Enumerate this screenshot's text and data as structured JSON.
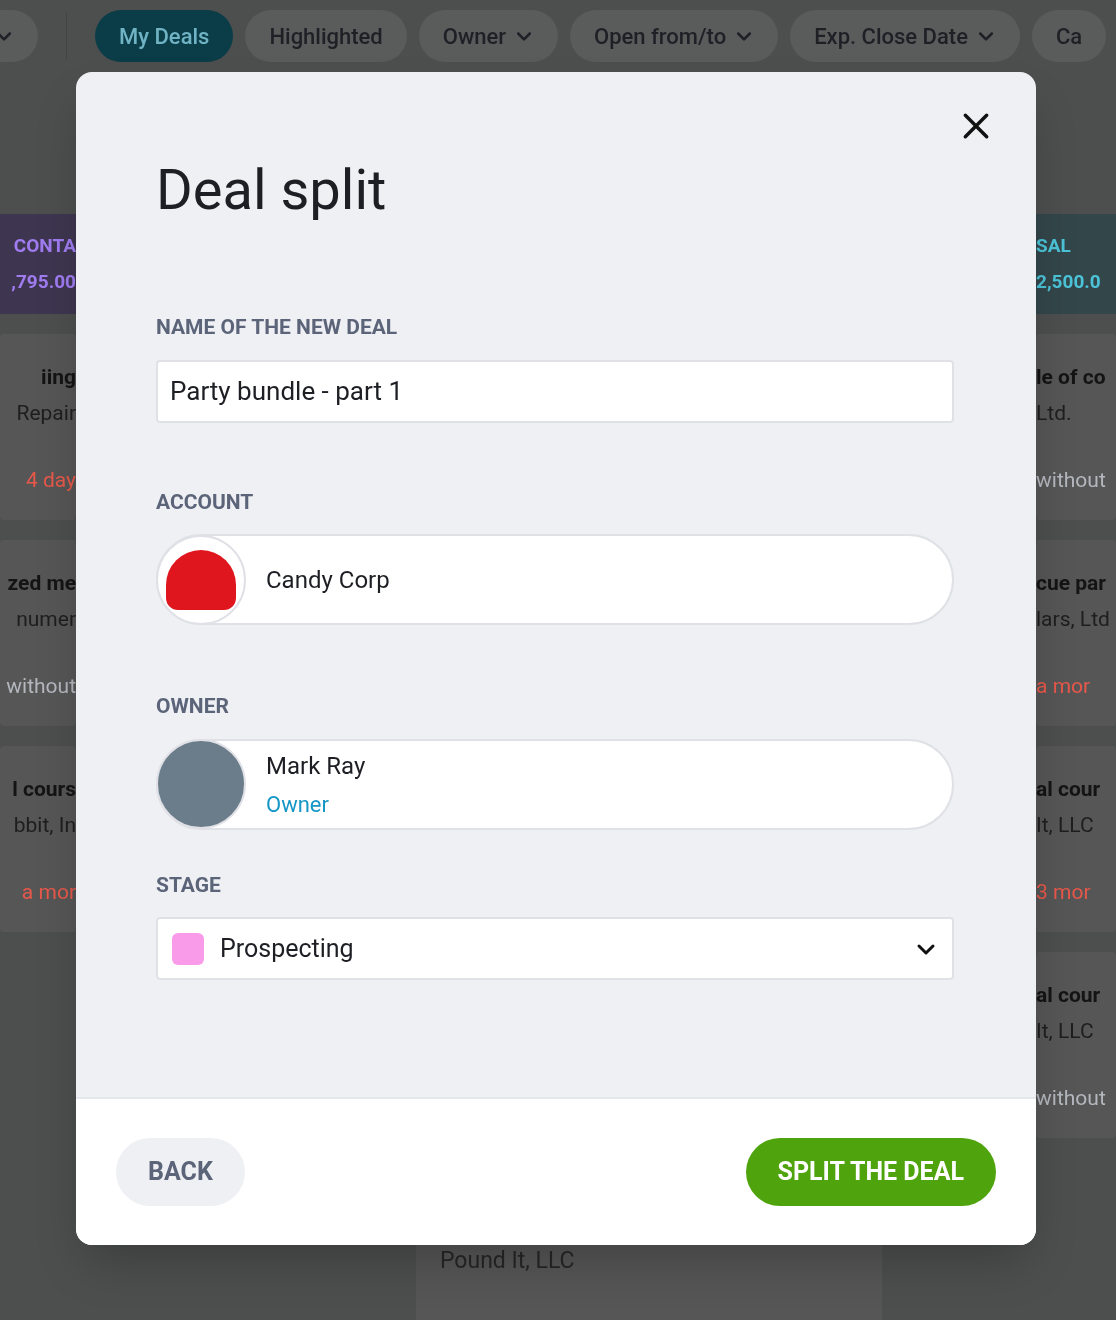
{
  "filter_bar": {
    "chips": [
      {
        "dropdown": true,
        "selected": false
      },
      {
        "label": "My Deals",
        "dropdown": false,
        "selected": true
      },
      {
        "label": "Highlighted",
        "dropdown": false,
        "selected": false
      },
      {
        "label": "Owner",
        "dropdown": true,
        "selected": false
      },
      {
        "label": "Open from/to",
        "dropdown": true,
        "selected": false
      },
      {
        "label": "Exp. Close Date",
        "dropdown": true,
        "selected": false
      },
      {
        "label": "Ca",
        "dropdown": false,
        "selected": false
      }
    ]
  },
  "left_column": {
    "header": {
      "title": "CONTA",
      "amount": ",795.00"
    },
    "cards": [
      {
        "title": "iing",
        "subtitle": "Repair",
        "note": "4 day",
        "overdue": true
      },
      {
        "title": "zed me",
        "subtitle": "numer",
        "note": "without",
        "overdue": false
      },
      {
        "title": "l cours",
        "subtitle": "bbit, In",
        "note": "a mor",
        "overdue": true
      }
    ]
  },
  "right_column": {
    "header": {
      "title": "SAL",
      "amount": "2,500.0"
    },
    "cards": [
      {
        "title": "le of co",
        "subtitle": "Ltd.",
        "note": "without",
        "overdue": false
      },
      {
        "title": "cue par",
        "subtitle": "lars, Ltd",
        "note": "a mor",
        "overdue": true
      },
      {
        "title": "al cour",
        "subtitle": "It, LLC",
        "note": "3 mor",
        "overdue": true
      },
      {
        "title": "al cour",
        "subtitle": "It, LLC",
        "note": "without",
        "overdue": false
      }
    ]
  },
  "bottom_card": {
    "subtitle": "Pound It, LLC"
  },
  "dialog": {
    "title": "Deal split",
    "name_field": {
      "label": "NAME OF THE NEW DEAL",
      "value": "Party bundle - part 1"
    },
    "account": {
      "label": "ACCOUNT",
      "name": "Candy Corp"
    },
    "owner": {
      "label": "OWNER",
      "name": "Mark Ray",
      "role": "Owner"
    },
    "stage": {
      "label": "STAGE",
      "value": "Prospecting",
      "color": "#f99be8"
    },
    "buttons": [
      {
        "label": "BACK",
        "kind": "secondary"
      },
      {
        "label": "SPLIT THE DEAL",
        "kind": "primary"
      }
    ]
  }
}
